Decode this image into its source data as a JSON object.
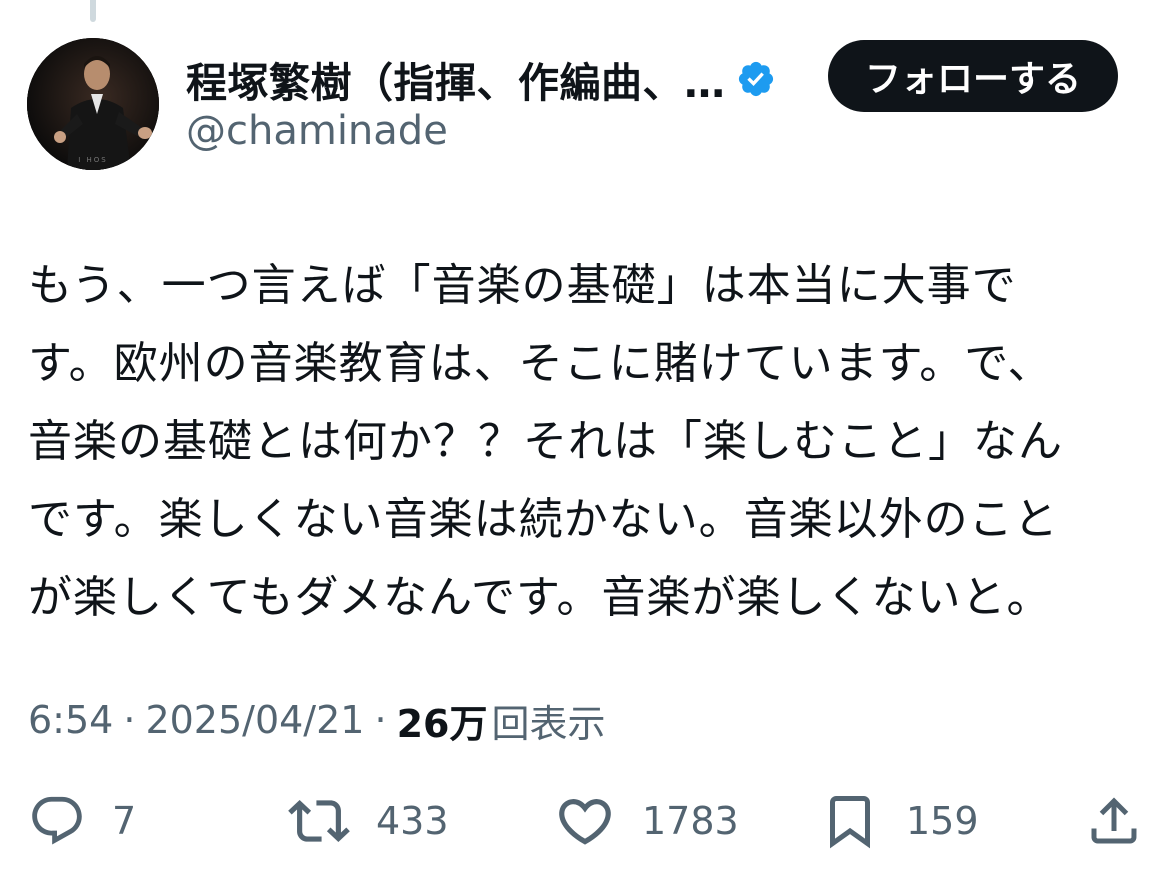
{
  "author": {
    "display_name": "程塚繁樹（指揮、作編曲、…",
    "handle": "@chaminade",
    "verified": true,
    "avatar_icon": "conductor-portrait"
  },
  "follow_button": {
    "label": "フォローする"
  },
  "tweet": {
    "lines": [
      "もう、一つ言えば「音楽の基礎」は本当に大事で",
      "す。欧州の音楽教育は、そこに賭けています。で、",
      "音楽の基礎とは何か？？それは「楽しむこと」なん",
      "です。楽しくない音楽は続かない。音楽以外のこと",
      "が楽しくてもダメなんです。音楽が楽しくないと。"
    ]
  },
  "meta": {
    "time": "6:54",
    "separator": "·",
    "date": "2025/04/21",
    "views_count": "26万",
    "views_label": "回表示"
  },
  "actions": {
    "replies": "7",
    "retweets": "433",
    "likes": "1783",
    "bookmarks": "159"
  },
  "colors": {
    "text_primary": "#0f1419",
    "text_secondary": "#536471",
    "verified_blue": "#1d9bf0",
    "follow_button_bg": "#0f1419"
  }
}
